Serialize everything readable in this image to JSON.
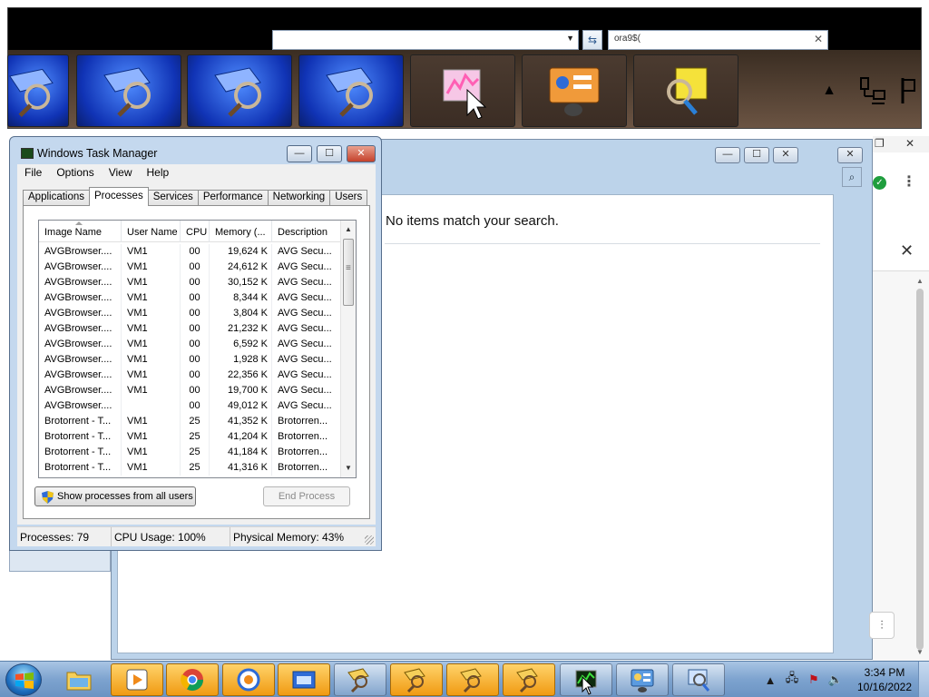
{
  "colors": {
    "taskbar": "#7da3cf",
    "window_frame": "#c4d8ee",
    "close_button": "#c4412b",
    "accent_green": "#1f9e3e"
  },
  "switcher": {
    "thumbnails": [
      {
        "icon": "network-search-icon",
        "style": "blue",
        "partial": true
      },
      {
        "icon": "network-search-icon",
        "style": "blue"
      },
      {
        "icon": "network-search-icon",
        "style": "blue"
      },
      {
        "icon": "network-search-icon",
        "style": "blue"
      },
      {
        "icon": "task-manager-chart-icon",
        "style": "brown",
        "hover": true
      },
      {
        "icon": "control-panel-icon",
        "style": "brown"
      },
      {
        "icon": "yellow-folder-search-icon",
        "style": "brown"
      }
    ],
    "tray_icons": [
      "show-hidden-icons-arrow",
      "network-icon",
      "action-center-flag-icon"
    ]
  },
  "background_window": {
    "search_text": "ora9$(",
    "no_results": "No items match your search.",
    "buttons": {
      "minimize": "—",
      "maximize": "☐",
      "close": "✕"
    }
  },
  "browser_fragment": {
    "top_buttons": [
      "❐",
      "✕"
    ],
    "search_icon": "magnifier-icon",
    "menu_icon": "⋮",
    "close_glyph": "✕",
    "filter_icon": "sliders-icon"
  },
  "task_manager": {
    "title": "Windows Task Manager",
    "menu": [
      "File",
      "Options",
      "View",
      "Help"
    ],
    "tabs": [
      "Applications",
      "Processes",
      "Services",
      "Performance",
      "Networking",
      "Users"
    ],
    "active_tab": "Processes",
    "columns": [
      "Image Name",
      "User Name",
      "CPU",
      "Memory (...",
      "Description"
    ],
    "sorted_column": "Image Name",
    "rows": [
      {
        "image": "AVGBrowser....",
        "user": "VM1",
        "cpu": "00",
        "mem": "19,624 K",
        "desc": "AVG Secu..."
      },
      {
        "image": "AVGBrowser....",
        "user": "VM1",
        "cpu": "00",
        "mem": "24,612 K",
        "desc": "AVG Secu..."
      },
      {
        "image": "AVGBrowser....",
        "user": "VM1",
        "cpu": "00",
        "mem": "30,152 K",
        "desc": "AVG Secu..."
      },
      {
        "image": "AVGBrowser....",
        "user": "VM1",
        "cpu": "00",
        "mem": "8,344 K",
        "desc": "AVG Secu..."
      },
      {
        "image": "AVGBrowser....",
        "user": "VM1",
        "cpu": "00",
        "mem": "3,804 K",
        "desc": "AVG Secu..."
      },
      {
        "image": "AVGBrowser....",
        "user": "VM1",
        "cpu": "00",
        "mem": "21,232 K",
        "desc": "AVG Secu..."
      },
      {
        "image": "AVGBrowser....",
        "user": "VM1",
        "cpu": "00",
        "mem": "6,592 K",
        "desc": "AVG Secu..."
      },
      {
        "image": "AVGBrowser....",
        "user": "VM1",
        "cpu": "00",
        "mem": "1,928 K",
        "desc": "AVG Secu..."
      },
      {
        "image": "AVGBrowser....",
        "user": "VM1",
        "cpu": "00",
        "mem": "22,356 K",
        "desc": "AVG Secu..."
      },
      {
        "image": "AVGBrowser....",
        "user": "VM1",
        "cpu": "00",
        "mem": "19,700 K",
        "desc": "AVG Secu..."
      },
      {
        "image": "AVGBrowser....",
        "user": "",
        "cpu": "00",
        "mem": "49,012 K",
        "desc": "AVG Secu..."
      },
      {
        "image": "Brotorrent - T...",
        "user": "VM1",
        "cpu": "25",
        "mem": "41,352 K",
        "desc": "Brotorren..."
      },
      {
        "image": "Brotorrent - T...",
        "user": "VM1",
        "cpu": "25",
        "mem": "41,204 K",
        "desc": "Brotorren..."
      },
      {
        "image": "Brotorrent - T...",
        "user": "VM1",
        "cpu": "25",
        "mem": "41,184 K",
        "desc": "Brotorren..."
      },
      {
        "image": "Brotorrent - T...",
        "user": "VM1",
        "cpu": "25",
        "mem": "41,316 K",
        "desc": "Brotorren..."
      }
    ],
    "show_all_button": "Show processes from all users",
    "end_process_button": "End Process",
    "status": {
      "processes": "Processes: 79",
      "cpu": "CPU Usage: 100%",
      "memory": "Physical Memory: 43%"
    }
  },
  "taskbar": {
    "start_icon": "windows-start-orb-icon",
    "buttons": [
      {
        "name": "explorer",
        "icon": "folder-icon",
        "style": "pin"
      },
      {
        "name": "media-player",
        "icon": "media-player-icon",
        "style": "hot"
      },
      {
        "name": "chrome",
        "icon": "chrome-icon",
        "style": "hot"
      },
      {
        "name": "avast",
        "icon": "security-icon",
        "style": "hot"
      },
      {
        "name": "app-window",
        "icon": "blue-window-icon",
        "style": "hot"
      },
      {
        "name": "network-search-1",
        "icon": "network-search-icon",
        "style": "normal"
      },
      {
        "name": "network-search-2",
        "icon": "network-search-icon",
        "style": "hot"
      },
      {
        "name": "network-search-3",
        "icon": "network-search-icon",
        "style": "hot"
      },
      {
        "name": "network-search-4",
        "icon": "network-search-icon",
        "style": "hot"
      },
      {
        "name": "task-manager",
        "icon": "task-manager-chart-icon",
        "style": "normal"
      },
      {
        "name": "control-panel",
        "icon": "control-panel-icon",
        "style": "normal"
      },
      {
        "name": "folder-search",
        "icon": "monitor-search-icon",
        "style": "normal"
      }
    ],
    "tray": [
      "show-hidden-arrow",
      "network-icon",
      "action-center-flag-icon",
      "volume-icon"
    ],
    "time": "3:34 PM",
    "date": "10/16/2022"
  }
}
